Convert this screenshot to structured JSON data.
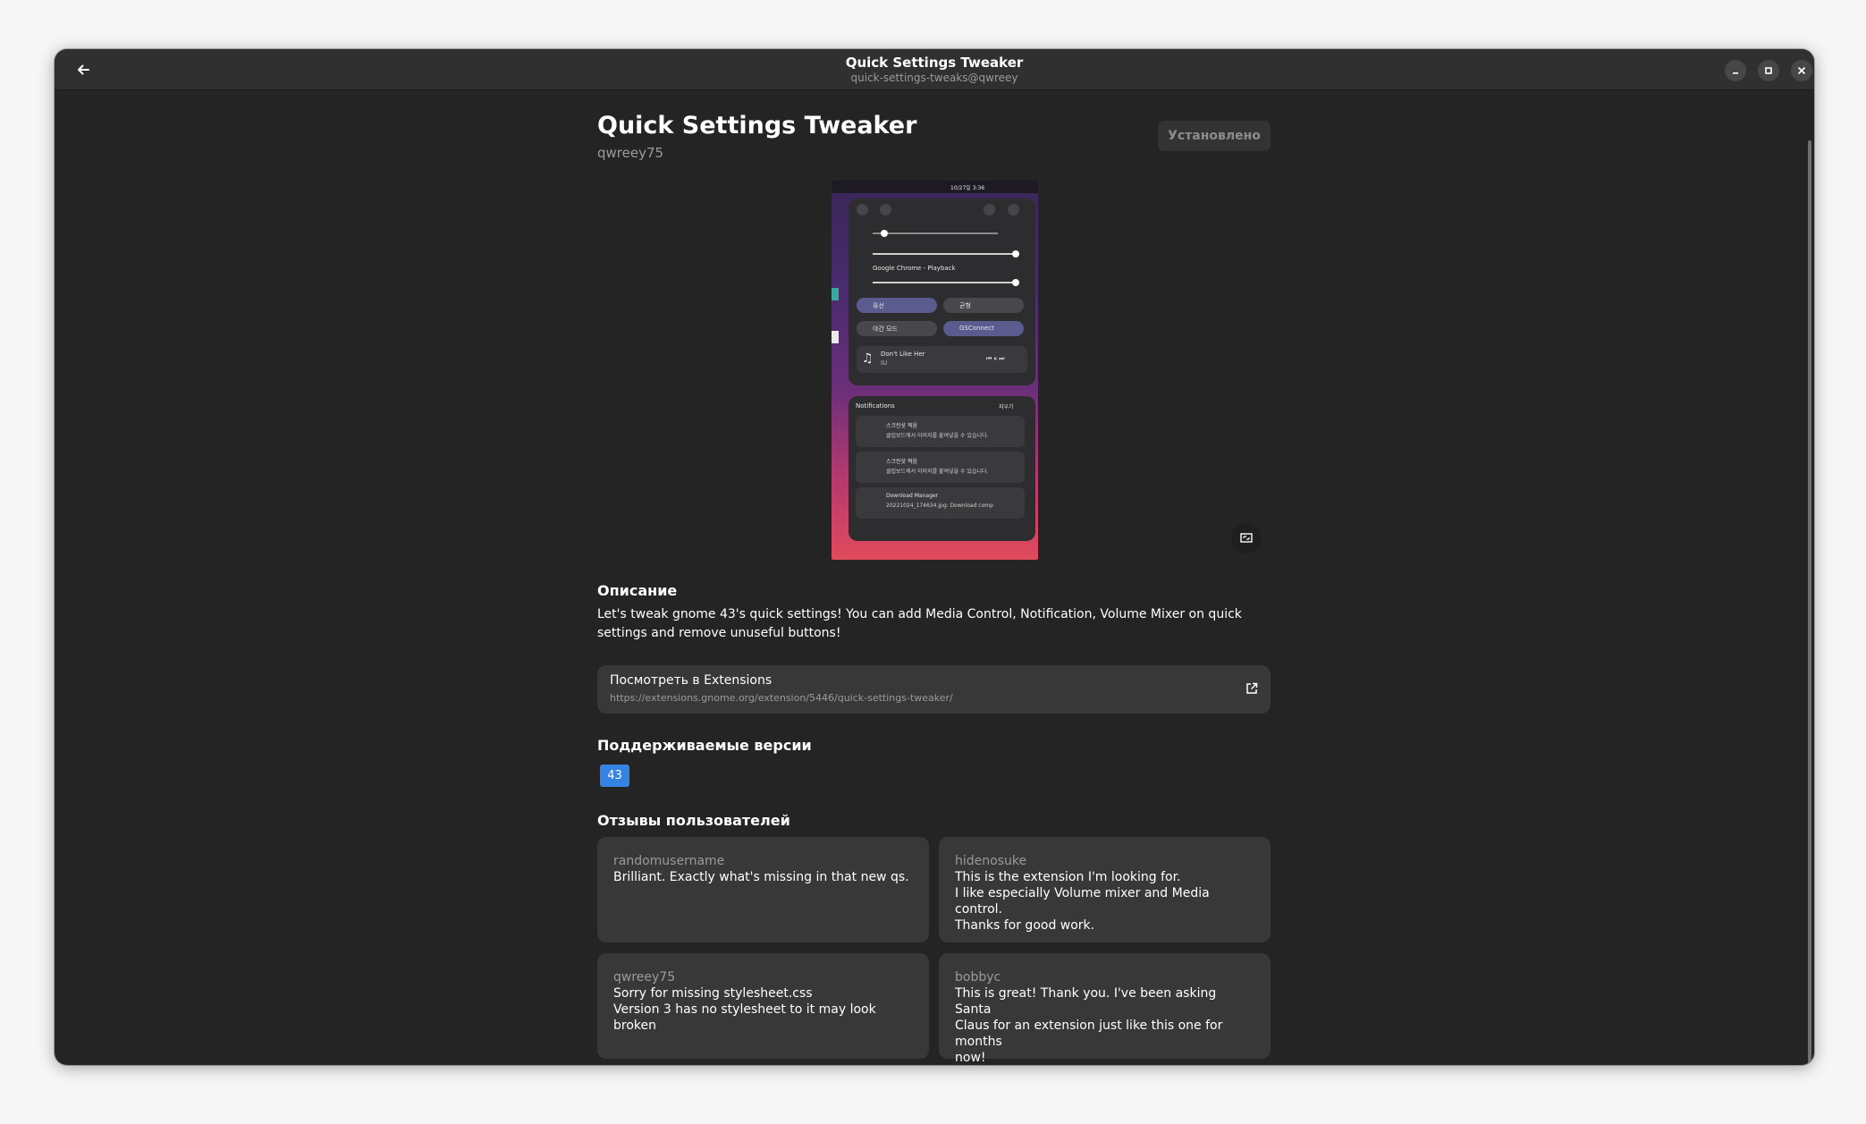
{
  "window": {
    "title": "Quick Settings Tweaker",
    "subtitle": "quick-settings-tweaks@qwreey"
  },
  "extension": {
    "name": "Quick Settings Tweaker",
    "author": "qwreey75",
    "install_label": "Установлено"
  },
  "screenshot": {
    "status_time": "10/27일  3:36",
    "media_app": "Google Chrome - Playback",
    "tile_wired": "유선",
    "tile_power": "균형",
    "tile_night": "야간 모드",
    "tile_gsconnect": "GSConnect",
    "song_title": "Don't Like Her",
    "song_artist": "IU",
    "notifications_title": "Notifications",
    "clear_label": "지우기",
    "notif1_title": "스크린샷 찍음",
    "notif1_body": "클립보드에서 이미지를 붙여넣을 수 있습니다.",
    "notif2_title": "스크린샷 찍음",
    "notif2_body": "클립보드에서 이미지를 붙여넣을 수 있습니다.",
    "notif3_title": "Download Manager",
    "notif3_body": "20221024_174634.jpg: Download comp"
  },
  "description": {
    "heading": "Описание",
    "text": "Let's tweak gnome 43's quick settings! You can add Media Control, Notification, Volume Mixer on quick settings and remove unuseful buttons!"
  },
  "link": {
    "title": "Посмотреть в Extensions",
    "url": "https://extensions.gnome.org/extension/5446/quick-settings-tweaker/"
  },
  "versions": {
    "heading": "Поддерживаемые версии",
    "items": [
      "43"
    ]
  },
  "reviews": {
    "heading": "Отзывы пользователей",
    "items": [
      {
        "user": "randomusername",
        "text": "Brilliant. Exactly what's missing in that new qs."
      },
      {
        "user": "hidenosuke",
        "text": "This is the extension I'm looking for.\nI like especially Volume mixer and Media control.\nThanks for good work."
      },
      {
        "user": "qwreey75",
        "text": "Sorry for missing stylesheet.css\nVersion 3 has no stylesheet to it may look broken"
      },
      {
        "user": "bobbyc",
        "text": "This is great! Thank you. I've been asking Santa\nClaus for an extension just like this one for months\nnow!"
      }
    ]
  },
  "colors": {
    "window_bg": "#242424",
    "card_bg": "#383838",
    "accent": "#3584e4"
  }
}
